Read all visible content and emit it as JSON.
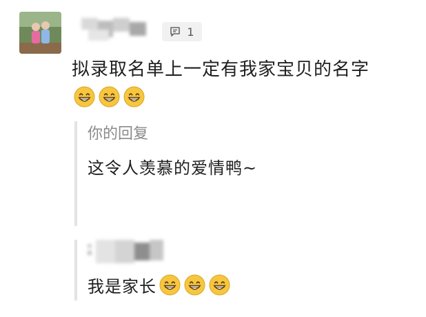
{
  "comment": {
    "reply_count": "1",
    "text": "拟录取名单上一定有我家宝贝的名字",
    "emojis": [
      "grinning-face",
      "grinning-face",
      "grinning-face"
    ]
  },
  "my_reply": {
    "label": "你的回复",
    "text": "这令人羡慕的爱情鸭~"
  },
  "second_reply": {
    "text": "我是家长",
    "emojis": [
      "grinning-face",
      "grinning-face",
      "grinning-face"
    ]
  },
  "colors": {
    "text": "#1f1f1f",
    "muted": "#8a8a8a",
    "quote_bar": "#e3e3e3",
    "emoji_face": "#f6c63f"
  }
}
